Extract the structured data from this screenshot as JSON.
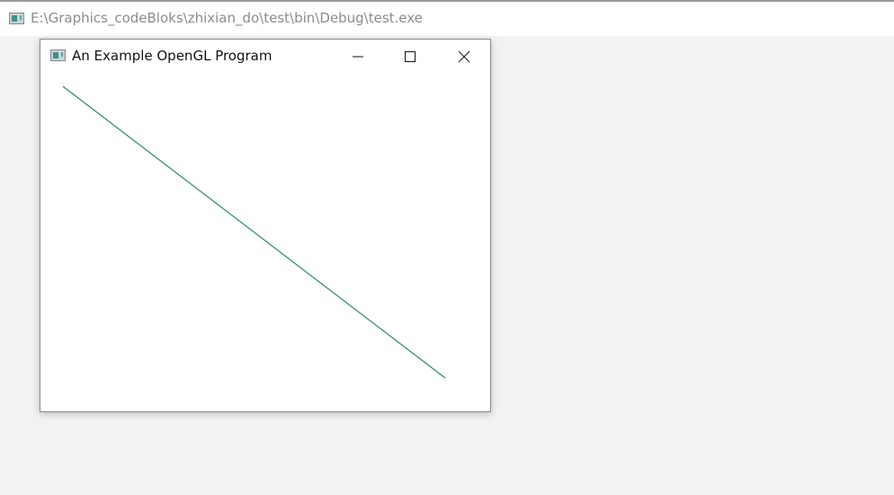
{
  "console_window": {
    "title": "E:\\Graphics_codeBloks\\zhixian_do\\test\\bin\\Debug\\test.exe",
    "icon": "application-icon"
  },
  "gl_window": {
    "title": "An Example OpenGL Program",
    "icon": "application-icon",
    "controls": {
      "minimize_icon": "minimize-icon",
      "maximize_icon": "maximize-icon",
      "close_icon": "close-icon"
    },
    "drawing": {
      "line_color": "#2e8b57",
      "background_color": "#ffffff"
    }
  }
}
